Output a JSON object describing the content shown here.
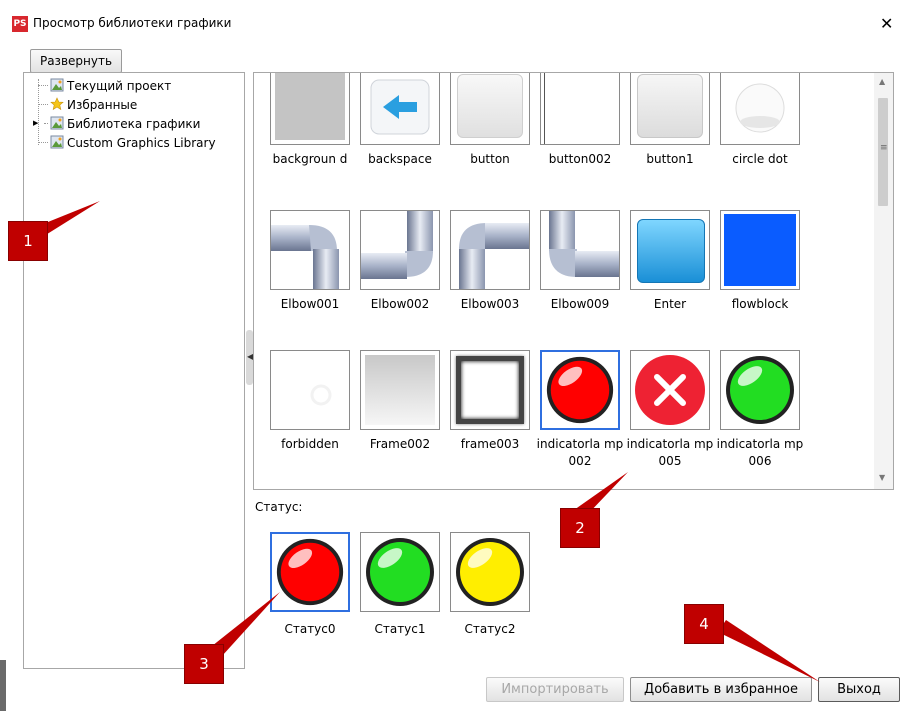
{
  "window": {
    "app_icon": "PS",
    "title": "Просмотр библиотеки графики",
    "close_glyph": "✕"
  },
  "toolbar": {
    "expand_label": "Развернуть"
  },
  "tree": {
    "items": [
      {
        "label": "Текущий проект",
        "icon": "folder-image-icon"
      },
      {
        "label": "Избранные",
        "icon": "star-icon"
      },
      {
        "label": "Библиотека графики",
        "icon": "folder-image-icon"
      },
      {
        "label": "Custom Graphics Library",
        "icon": "folder-image-icon"
      }
    ]
  },
  "gallery": {
    "rows": [
      [
        {
          "name": "background",
          "caption": "backgroun d"
        },
        {
          "name": "backspace",
          "caption": "backspace"
        },
        {
          "name": "button",
          "caption": "button"
        },
        {
          "name": "button002",
          "caption": "button002"
        },
        {
          "name": "button1",
          "caption": "button1"
        },
        {
          "name": "circle dot",
          "caption": "circle dot"
        }
      ],
      [
        {
          "name": "Elbow001",
          "caption": "Elbow001"
        },
        {
          "name": "Elbow002",
          "caption": "Elbow002"
        },
        {
          "name": "Elbow003",
          "caption": "Elbow003"
        },
        {
          "name": "Elbow009",
          "caption": "Elbow009"
        },
        {
          "name": "Enter",
          "caption": "Enter"
        },
        {
          "name": "flowblock",
          "caption": "flowblock"
        }
      ],
      [
        {
          "name": "forbidden",
          "caption": "forbidden"
        },
        {
          "name": "Frame002",
          "caption": "Frame002"
        },
        {
          "name": "frame003",
          "caption": "frame003"
        },
        {
          "name": "indicatorlamp002",
          "caption": "indicatorla mp002",
          "selected": true
        },
        {
          "name": "indicatorlamp005",
          "caption": "indicatorla mp005"
        },
        {
          "name": "indicatorlamp006",
          "caption": "indicatorla mp006"
        }
      ]
    ]
  },
  "status": {
    "label": "Статус:",
    "items": [
      {
        "caption": "Статус0",
        "color": "#ff0000",
        "selected": true
      },
      {
        "caption": "Статус1",
        "color": "#22dd22"
      },
      {
        "caption": "Статус2",
        "color": "#ffee00"
      }
    ]
  },
  "buttons": {
    "import": "Импортировать",
    "add_favorite": "Добавить в избранное",
    "exit": "Выход"
  },
  "callouts": [
    {
      "label": "1"
    },
    {
      "label": "2"
    },
    {
      "label": "3"
    },
    {
      "label": "4"
    }
  ],
  "colors": {
    "accent_select": "#2f6fe0",
    "callout": "#c00000"
  }
}
